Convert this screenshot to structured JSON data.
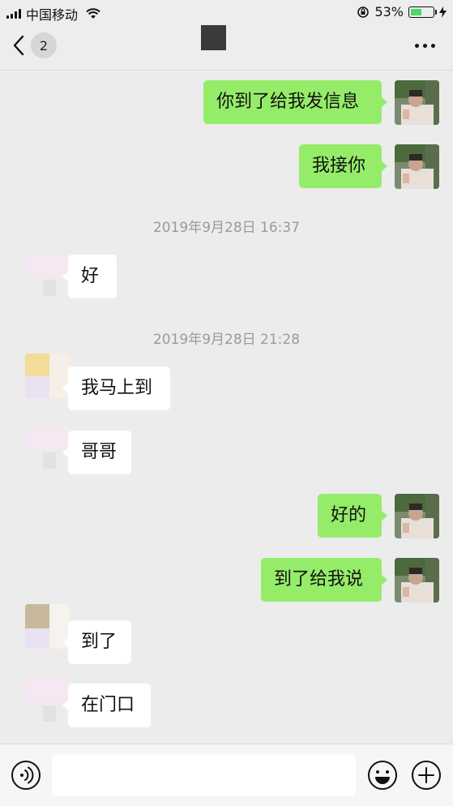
{
  "status_bar": {
    "carrier": "中国移动",
    "battery_percent": "53%",
    "battery_level": 0.53,
    "battery_color": "#4cd964"
  },
  "nav": {
    "back_count": "2",
    "back_icon": "chevron-left-icon",
    "more_icon": "more-dots-icon"
  },
  "messages": [
    {
      "side": "me",
      "text": "你到了给我发信息"
    },
    {
      "side": "me",
      "text": "我接你"
    },
    {
      "type": "timestamp",
      "text": "2019年9月28日 16:37"
    },
    {
      "side": "them",
      "text": "好"
    },
    {
      "type": "timestamp",
      "text": "2019年9月28日 21:28"
    },
    {
      "side": "them",
      "text": "我马上到"
    },
    {
      "side": "them",
      "text": "哥哥"
    },
    {
      "side": "me",
      "text": "好的"
    },
    {
      "side": "me",
      "text": "到了给我说"
    },
    {
      "side": "them",
      "text": "到了"
    },
    {
      "side": "them",
      "text": "在门口"
    }
  ],
  "input_bar": {
    "voice_icon": "voice-icon",
    "emoji_icon": "emoji-icon",
    "plus_icon": "plus-icon",
    "text_value": ""
  },
  "colors": {
    "my_bubble": "#95ec69",
    "their_bubble": "#ffffff",
    "background": "#ececec"
  }
}
